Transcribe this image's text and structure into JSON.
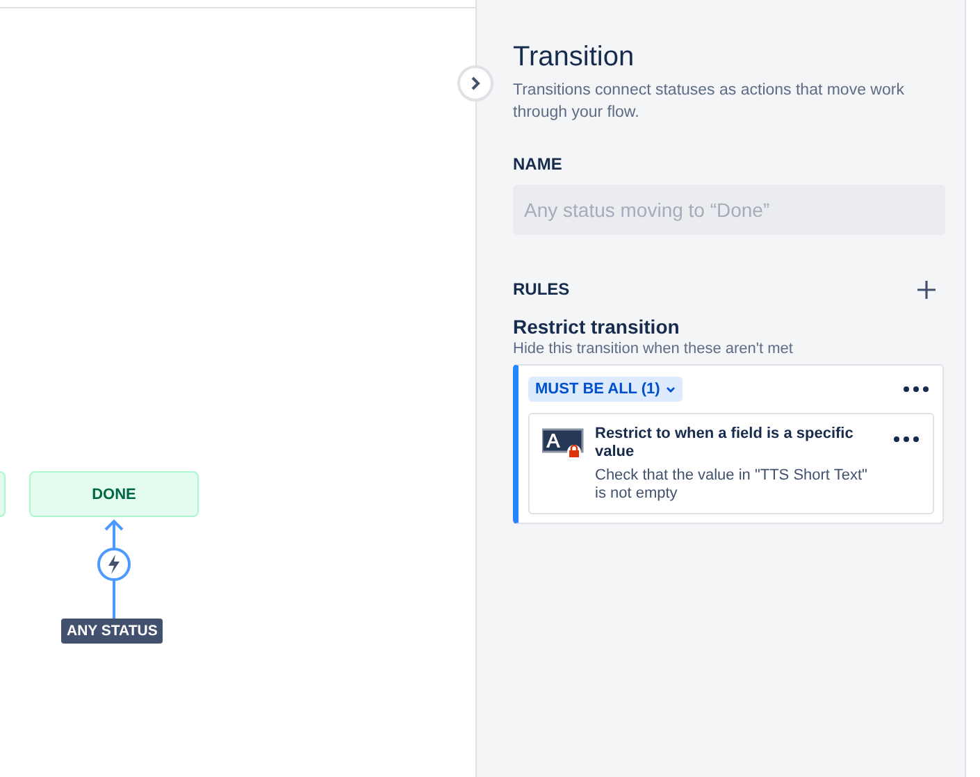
{
  "canvas": {
    "status_node": {
      "label": "DONE"
    },
    "source_badge": {
      "label": "ANY STATUS"
    }
  },
  "panel": {
    "title": "Transition",
    "description": "Transitions connect statuses as actions that move work through your flow.",
    "name_field": {
      "label": "NAME",
      "placeholder": "Any status moving to “Done”"
    },
    "rules": {
      "label": "RULES",
      "group_title": "Restrict transition",
      "group_hint": "Hide this transition when these aren't met",
      "condition_group": {
        "label": "MUST BE ALL (1)",
        "rules": [
          {
            "title": "Restrict to when a field is a specific value",
            "description": "Check that the value in \"TTS Short Text\" is not empty"
          }
        ]
      }
    }
  }
}
